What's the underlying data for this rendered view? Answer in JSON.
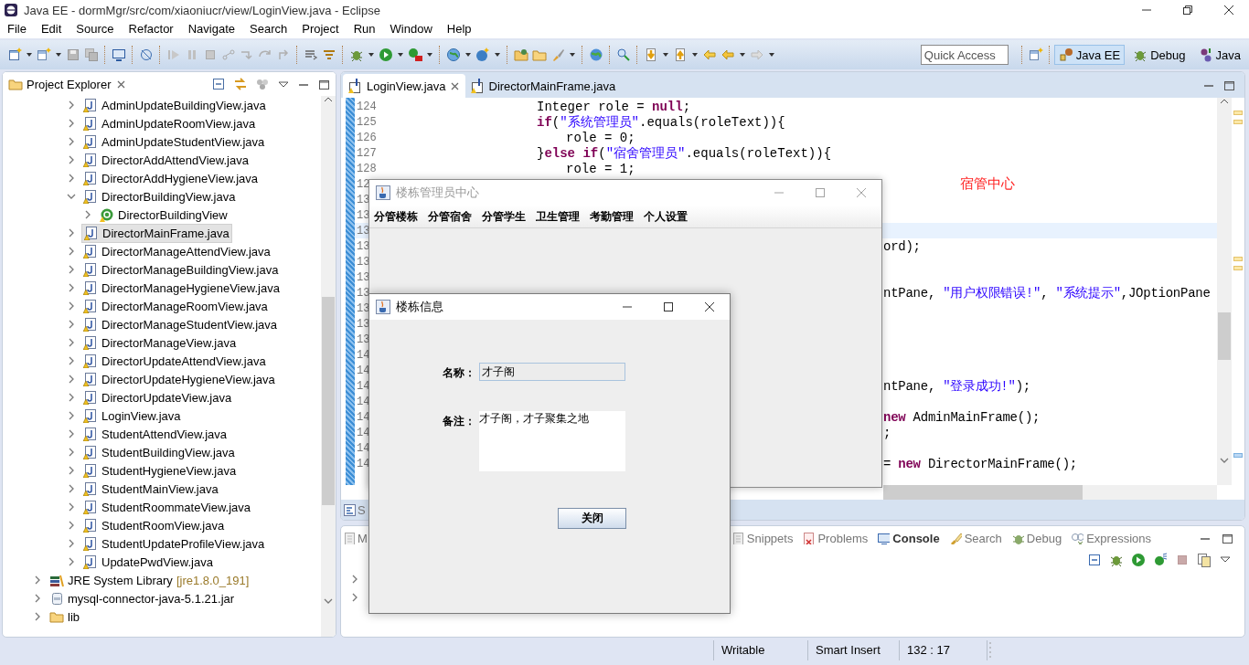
{
  "window": {
    "title": "Java EE - dormMgr/src/com/xiaoniucr/view/LoginView.java - Eclipse"
  },
  "menu": [
    "File",
    "Edit",
    "Source",
    "Refactor",
    "Navigate",
    "Search",
    "Project",
    "Run",
    "Window",
    "Help"
  ],
  "quick_access": {
    "placeholder": "Quick Access"
  },
  "perspectives": [
    {
      "label": "Java EE",
      "selected": true
    },
    {
      "label": "Debug",
      "selected": false
    },
    {
      "label": "Java",
      "selected": false
    }
  ],
  "project_explorer": {
    "title": "Project Explorer",
    "tree": [
      {
        "children": [
          {
            "label": "AdminUpdateBuildingView.java",
            "kind": "java-file",
            "expanded": false,
            "selected": false
          },
          {
            "label": "AdminUpdateRoomView.java",
            "kind": "java-file",
            "expanded": false,
            "selected": false
          },
          {
            "label": "AdminUpdateStudentView.java",
            "kind": "java-file",
            "expanded": false,
            "selected": false
          },
          {
            "label": "DirectorAddAttendView.java",
            "kind": "java-file",
            "expanded": false,
            "selected": false
          },
          {
            "label": "DirectorAddHygieneView.java",
            "kind": "java-file",
            "expanded": false,
            "selected": false
          },
          {
            "label": "DirectorBuildingView.java",
            "kind": "java-file",
            "expanded": true,
            "selected": false,
            "children": [
              {
                "label": "DirectorBuildingView",
                "kind": "class",
                "expanded": false,
                "selected": false
              }
            ]
          },
          {
            "label": "DirectorMainFrame.java",
            "kind": "java-file",
            "expanded": false,
            "selected": true
          },
          {
            "label": "DirectorManageAttendView.java",
            "kind": "java-file",
            "expanded": false,
            "selected": false
          },
          {
            "label": "DirectorManageBuildingView.java",
            "kind": "java-file",
            "expanded": false,
            "selected": false
          },
          {
            "label": "DirectorManageHygieneView.java",
            "kind": "java-file",
            "expanded": false,
            "selected": false
          },
          {
            "label": "DirectorManageRoomView.java",
            "kind": "java-file",
            "expanded": false,
            "selected": false
          },
          {
            "label": "DirectorManageStudentView.java",
            "kind": "java-file",
            "expanded": false,
            "selected": false
          },
          {
            "label": "DirectorManageView.java",
            "kind": "java-file",
            "expanded": false,
            "selected": false
          },
          {
            "label": "DirectorUpdateAttendView.java",
            "kind": "java-file",
            "expanded": false,
            "selected": false
          },
          {
            "label": "DirectorUpdateHygieneView.java",
            "kind": "java-file",
            "expanded": false,
            "selected": false
          },
          {
            "label": "DirectorUpdateView.java",
            "kind": "java-file",
            "expanded": false,
            "selected": false
          },
          {
            "label": "LoginView.java",
            "kind": "java-file",
            "expanded": false,
            "selected": false
          },
          {
            "label": "StudentAttendView.java",
            "kind": "java-file",
            "expanded": false,
            "selected": false
          },
          {
            "label": "StudentBuildingView.java",
            "kind": "java-file",
            "expanded": false,
            "selected": false
          },
          {
            "label": "StudentHygieneView.java",
            "kind": "java-file",
            "expanded": false,
            "selected": false
          },
          {
            "label": "StudentMainView.java",
            "kind": "java-file",
            "expanded": false,
            "selected": false
          },
          {
            "label": "StudentRoommateView.java",
            "kind": "java-file",
            "expanded": false,
            "selected": false
          },
          {
            "label": "StudentRoomView.java",
            "kind": "java-file",
            "expanded": false,
            "selected": false
          },
          {
            "label": "StudentUpdateProfileView.java",
            "kind": "java-file",
            "expanded": false,
            "selected": false
          },
          {
            "label": "UpdatePwdView.java",
            "kind": "java-file",
            "expanded": false,
            "selected": false
          }
        ]
      },
      {
        "label": "JRE System Library",
        "decoration": "[jre1.8.0_191]",
        "kind": "library",
        "expanded": false,
        "selected": false
      },
      {
        "label": "mysql-connector-java-5.1.21.jar",
        "kind": "jar",
        "expanded": false,
        "selected": false
      },
      {
        "label": "lib",
        "kind": "folder",
        "expanded": false,
        "selected": false
      }
    ]
  },
  "editor": {
    "tabs": [
      {
        "label": "LoginView.java",
        "selected": true
      },
      {
        "label": "DirectorMainFrame.java",
        "selected": false
      }
    ],
    "lines": [
      {
        "number": "124",
        "kind": "code",
        "current": false,
        "tokens": [
          {
            "text": "Integer role = ",
            "kind": "plain"
          },
          {
            "text": "null",
            "kind": "keyword"
          },
          {
            "text": ";",
            "kind": "plain"
          }
        ]
      },
      {
        "number": "125",
        "kind": "code",
        "current": false,
        "tokens": [
          {
            "text": "if",
            "kind": "keyword"
          },
          {
            "text": "(",
            "kind": "plain"
          },
          {
            "text": "\"系统管理员\"",
            "kind": "string"
          },
          {
            "text": ".equals(roleText)){",
            "kind": "plain"
          }
        ]
      },
      {
        "number": "126",
        "kind": "code-deep",
        "current": false,
        "tokens": [
          {
            "text": "role = 0;",
            "kind": "plain"
          }
        ]
      },
      {
        "number": "127",
        "kind": "code",
        "current": false,
        "tokens": [
          {
            "text": "}",
            "kind": "plain"
          },
          {
            "text": "else if",
            "kind": "keyword"
          },
          {
            "text": "(",
            "kind": "plain"
          },
          {
            "text": "\"宿舍管理员\"",
            "kind": "string"
          },
          {
            "text": ".equals(roleText)){",
            "kind": "plain"
          }
        ]
      },
      {
        "number": "128",
        "kind": "code-deep",
        "current": false,
        "tokens": [
          {
            "text": "role = 1;",
            "kind": "plain"
          }
        ]
      },
      {
        "number": "12",
        "kind": "note",
        "current": false,
        "tokens": [
          {
            "text": "宿管中心",
            "kind": "annotation"
          }
        ]
      },
      {
        "number": "13",
        "current": false
      },
      {
        "number": "13",
        "current": false
      },
      {
        "number": "13",
        "current": true
      },
      {
        "number": "13",
        "kind": "tail",
        "current": false,
        "tokens": [
          {
            "text": "ord);",
            "kind": "plain"
          }
        ]
      },
      {
        "number": "13",
        "current": false
      },
      {
        "number": "13",
        "current": false
      },
      {
        "number": "13",
        "kind": "tail",
        "current": false,
        "tokens": [
          {
            "text": "ntPane, ",
            "kind": "plain"
          },
          {
            "text": "\"用户权限错误!\"",
            "kind": "string"
          },
          {
            "text": ", ",
            "kind": "plain"
          },
          {
            "text": "\"系统提示\"",
            "kind": "string"
          },
          {
            "text": ",JOptionPane",
            "kind": "plain"
          }
        ]
      },
      {
        "number": "13",
        "current": false
      },
      {
        "number": "13",
        "current": false
      },
      {
        "number": "13",
        "current": false
      },
      {
        "number": "14",
        "current": false
      },
      {
        "number": "14",
        "current": false
      },
      {
        "number": "14",
        "kind": "tail",
        "current": false,
        "tokens": [
          {
            "text": "ntPane, ",
            "kind": "plain"
          },
          {
            "text": "\"登录成功!\"",
            "kind": "string"
          },
          {
            "text": ");",
            "kind": "plain"
          }
        ]
      },
      {
        "number": "14",
        "current": false
      },
      {
        "number": "14",
        "kind": "tail",
        "current": false,
        "tokens": [
          {
            "text": "new",
            "kind": "keyword"
          },
          {
            "text": " AdminMainFrame();",
            "kind": "plain"
          }
        ]
      },
      {
        "number": "14",
        "kind": "tail",
        "current": false,
        "tokens": [
          {
            "text": ";",
            "kind": "plain"
          }
        ]
      },
      {
        "number": "14",
        "current": false
      },
      {
        "number": "14",
        "kind": "tail",
        "current": false,
        "tokens": [
          {
            "text": "= ",
            "kind": "plain"
          },
          {
            "text": "new",
            "kind": "keyword"
          },
          {
            "text": " DirectorMainFrame();",
            "kind": "plain"
          }
        ]
      }
    ]
  },
  "editor_bottom_tab": {
    "label": "S"
  },
  "bottom_panel": {
    "tabs": [
      {
        "label": "M",
        "selected": false
      },
      {
        "label": "Snippets",
        "selected": false
      },
      {
        "label": "Problems",
        "selected": false
      },
      {
        "label": "Console",
        "selected": true
      },
      {
        "label": "Search",
        "selected": false
      },
      {
        "label": "Debug",
        "selected": false
      },
      {
        "label": "Expressions",
        "selected": false
      }
    ]
  },
  "status_bar": [
    "Writable",
    "Smart Insert",
    "132 : 17"
  ],
  "frame": {
    "title": "楼栋管理员中心",
    "active": false,
    "menu": [
      "分管楼栋",
      "分管宿舍",
      "分管学生",
      "卫生管理",
      "考勤管理",
      "个人设置"
    ]
  },
  "dialog": {
    "title": "楼栋信息",
    "active": true,
    "fields": [
      {
        "label": "名称：",
        "value": "才子阁",
        "kind": "text"
      },
      {
        "label": "备注：",
        "value": "才子阁，才子聚集之地",
        "kind": "textarea"
      }
    ],
    "button": "关闭"
  }
}
